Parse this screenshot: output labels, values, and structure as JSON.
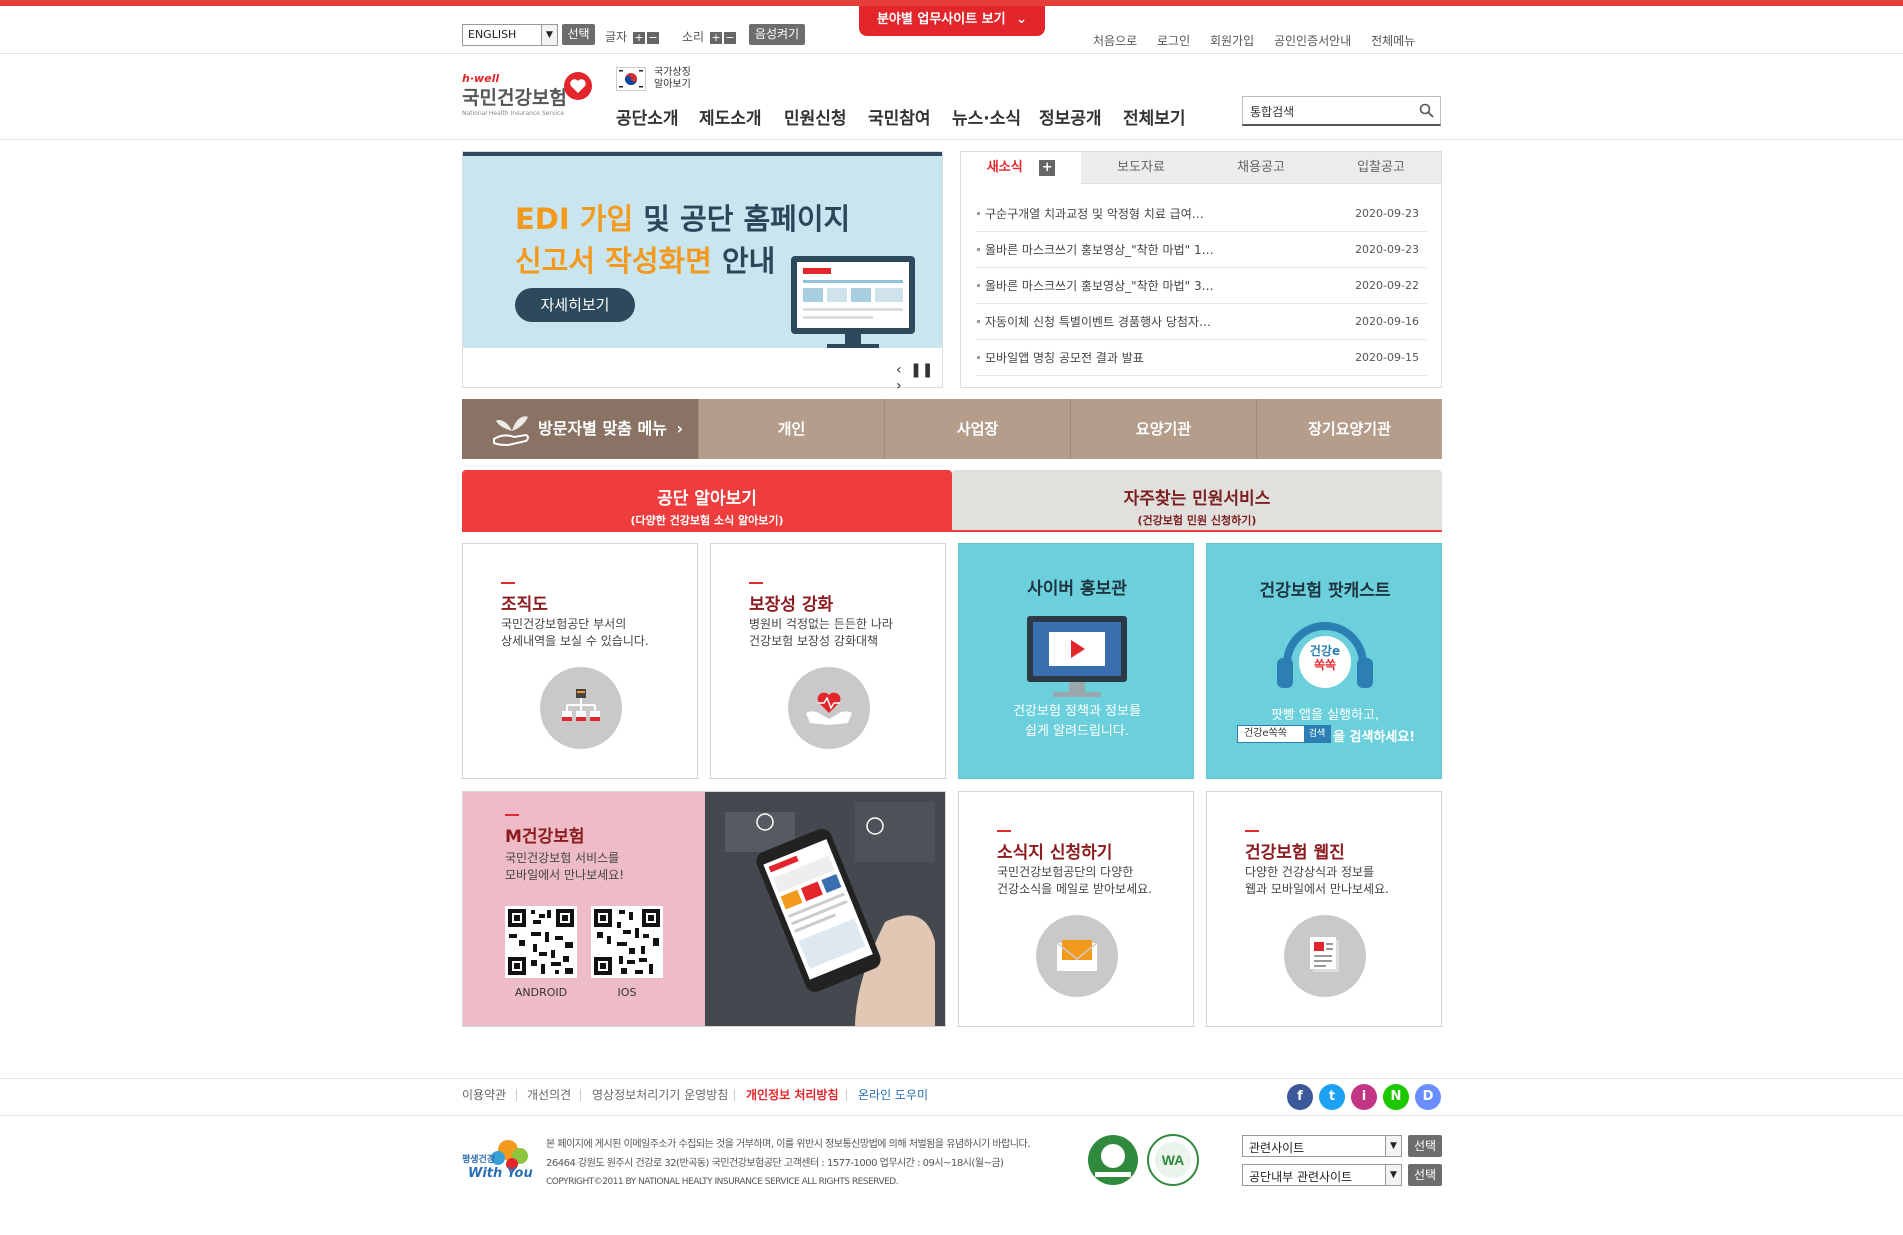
{
  "colors": {
    "brand_red": "#e3262b",
    "brown": "#8a7264",
    "teal": "#6bd0dc",
    "pink": "#edbcc6"
  },
  "util": {
    "language": "ENGLISH",
    "select_btn": "선택",
    "text_label": "글자",
    "sound_label": "소리",
    "voice_btn": "음성켜기",
    "field_sites": "분야별 업무사이트 보기",
    "links": [
      "처음으로",
      "로그인",
      "회원가입",
      "공인인증서안내",
      "전체메뉴"
    ]
  },
  "header": {
    "logo_small": "h·well",
    "logo_main": "국민건강보험",
    "logo_sub": "National Health Insurance Service",
    "symbol_text1": "국가상징",
    "symbol_text2": "알아보기",
    "gnb": [
      "공단소개",
      "제도소개",
      "민원신청",
      "국민참여",
      "뉴스·소식",
      "정보공개",
      "전체보기"
    ],
    "search_placeholder": "통합검색"
  },
  "banner": {
    "line1_orange": "EDI 가입",
    "line1_rest": " 및 공단 홈페이지",
    "line2_orange": "신고서 작성화면",
    "line2_rest": " 안내",
    "button": "자세히보기"
  },
  "news": {
    "tabs": [
      "새소식",
      "보도자료",
      "채용공고",
      "입찰공고"
    ],
    "plus": "+",
    "items": [
      {
        "title": "구순구개열 치과교정 및 악정형 치료 급여…",
        "date": "2020-09-23"
      },
      {
        "title": "올바른 마스크쓰기 홍보영상_\"착한 마법\" 1…",
        "date": "2020-09-23"
      },
      {
        "title": "올바른 마스크쓰기 홍보영상_\"착한 마법\" 3…",
        "date": "2020-09-22"
      },
      {
        "title": "자동이체 신청 특별이벤트 경품행사 당첨자…",
        "date": "2020-09-16"
      },
      {
        "title": "모바일앱 명칭 공모전 결과 발표",
        "date": "2020-09-15"
      }
    ]
  },
  "visitor": {
    "title": "방문자별 맞춤 메뉴",
    "items": [
      "개인",
      "사업장",
      "요양기관",
      "장기요양기관"
    ]
  },
  "tabs2": [
    {
      "title": "공단 알아보기",
      "sub": "(다양한 건강보험 소식 알아보기)"
    },
    {
      "title": "자주찾는 민원서비스",
      "sub": "(건강보험 민원 신청하기)"
    }
  ],
  "cards": {
    "org": {
      "title": "조직도",
      "desc1": "국민건강보험공단 부서의",
      "desc2": "상세내역을 보실 수 있습니다."
    },
    "coverage": {
      "title": "보장성 강화",
      "desc1": "병원비 걱정없는 든든한 나라",
      "desc2": "건강보험 보장성 강화대책"
    },
    "cyber": {
      "title": "사이버 홍보관",
      "desc1": "건강보험 정책과 정보를",
      "desc2": "쉽게 알려드립니다."
    },
    "podcast": {
      "title": "건강보험 팟캐스트",
      "desc1": "팟빵 앱을 실행하고,",
      "search_text": "건강e쏙쏙",
      "search_btn": "검색",
      "desc2": "을 검색하세요!",
      "logo1": "건강e",
      "logo2": "쏙쏙"
    },
    "mobile": {
      "title": "M건강보험",
      "desc1": "국민건강보험 서비스를",
      "desc2": "모바일에서 만나보세요!",
      "android": "ANDROID",
      "ios": "IOS"
    },
    "newsletter": {
      "title": "소식지 신청하기",
      "desc1": "국민건강보험공단의 다양한",
      "desc2": "건강소식을 메일로 받아보세요."
    },
    "webzine": {
      "title": "건강보험 웹진",
      "desc1": "다양한 건강상식과 정보를",
      "desc2": "웹과 모바일에서 만나보세요."
    }
  },
  "footer": {
    "links": [
      "이용약관",
      "개선의견",
      "영상정보처리기기 운영방침",
      "개인정보 처리방침",
      "온라인 도우미"
    ],
    "notice": "본 페이지에 게시된 이메일주소가 수집되는 것을 거부하며, 이를 위반시 정보통신망법에 의해 처벌됨을 유념하시기 바랍니다.",
    "address": "26464 강원도 원주시 건강로 32(반곡동) 국민건강보험공단 고객센터 : 1577-1000 업무시간 : 09시~18시(월~금)",
    "copyright": "COPYRIGHT©2011 BY NATIONAL HEALTY INSURANCE SERVICE ALL RIGHTS RESERVED.",
    "logo_top": "평생건강",
    "logo_bottom": "With You",
    "select1": "관련사이트",
    "select2": "공단내부 관련사이트",
    "select_btn": "선택",
    "sns": [
      "f",
      "t",
      "i",
      "N",
      "D"
    ]
  }
}
